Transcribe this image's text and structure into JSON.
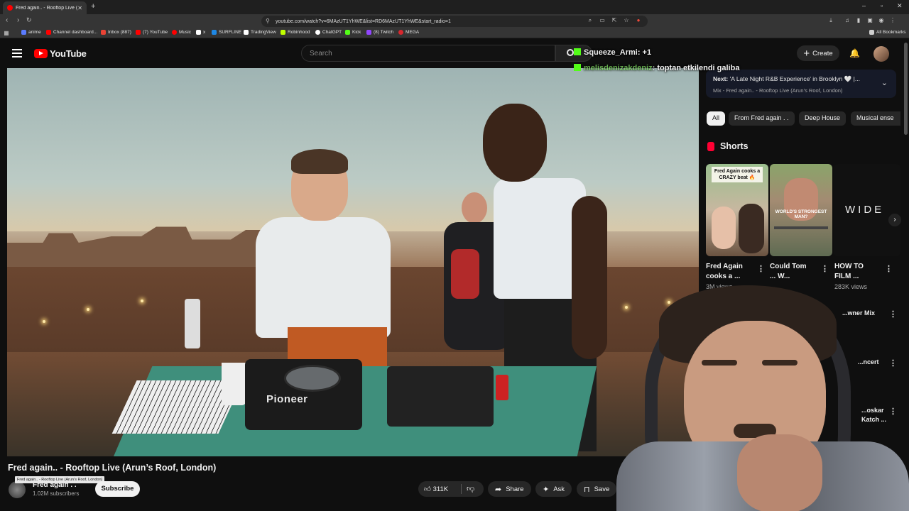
{
  "browser": {
    "tab_title": "Fred again.. - Rooftop Live (A",
    "url": "youtube.com/watch?v=6MAzUT1YhWE&list=RD6MAzUT1YhWE&start_radio=1",
    "extension_badge": "4",
    "bookmarks": [
      {
        "label": "anime",
        "color": "#5b7cff"
      },
      {
        "label": "Channel dashboard...",
        "color": "#ff0000"
      },
      {
        "label": "Inbox (887)",
        "color": "#ea4335"
      },
      {
        "label": "(7) YouTube",
        "color": "#ff0000"
      },
      {
        "label": "Music",
        "color": "#ff0000"
      },
      {
        "label": "x",
        "color": "#ffffff"
      },
      {
        "label": "SURFLINE",
        "color": "#1e88e5"
      },
      {
        "label": "TradingView",
        "color": "#ffffff"
      },
      {
        "label": "Robinhood",
        "color": "#c0ff00"
      },
      {
        "label": "ChatGPT",
        "color": "#ffffff"
      },
      {
        "label": "Kick",
        "color": "#53fc18"
      },
      {
        "label": "(8) Twitch",
        "color": "#9146ff"
      },
      {
        "label": "MEGA",
        "color": "#d9272e"
      }
    ],
    "all_bookmarks": "All Bookmarks"
  },
  "youtube": {
    "logo_text": "YouTube",
    "search_placeholder": "Search",
    "create_label": "Create"
  },
  "chat": [
    {
      "user": "Squeeze_Armi",
      "message": ": +1"
    },
    {
      "user": "melisdenizakdeniz",
      "message": ": toptan etkilendi galiba"
    }
  ],
  "video": {
    "brand_text": "Pioneer",
    "title": "Fred again.. - Rooftop Live (Arun’s Roof, London)",
    "tooltip": "Fred again.. - Rooftop Live (Arun’s Roof, London)",
    "channel": "Fred again . .",
    "subscribers": "1.02M subscribers",
    "subscribe_label": "Subscribe",
    "likes": "311K",
    "share_label": "Share",
    "ask_label": "Ask",
    "save_label": "Save"
  },
  "up_next": {
    "prefix": "Next:",
    "title": "'A Late Night R&B Experience' in Brooklyn 🤍 |...",
    "subtitle": "Mix - Fred again.. - Rooftop Live (Arun’s Roof, London)"
  },
  "chips": [
    "All",
    "From Fred again . .",
    "Deep House",
    "Musical ense"
  ],
  "shorts": {
    "header": "Shorts",
    "items": [
      {
        "thumb_text": "Fred Again cooks a CRAZY beat 🔥",
        "title_l1": "Fred Again",
        "title_l2": "cooks a ...",
        "views": "3M views"
      },
      {
        "thumb_text": "WORLD'S STRONGEST MAN?",
        "title_l1": "Could Tom",
        "title_l2": "... W...",
        "views": ""
      },
      {
        "thumb_text": "WIDE",
        "title_l1": "HOW TO",
        "title_l2": "FILM ...",
        "views": "283K views"
      }
    ]
  },
  "mix_items": [
    {
      "text": "...wner Mix"
    },
    {
      "text": "...ncert"
    },
    {
      "text": "...oskar"
    },
    {
      "text": "Katch ..."
    }
  ]
}
